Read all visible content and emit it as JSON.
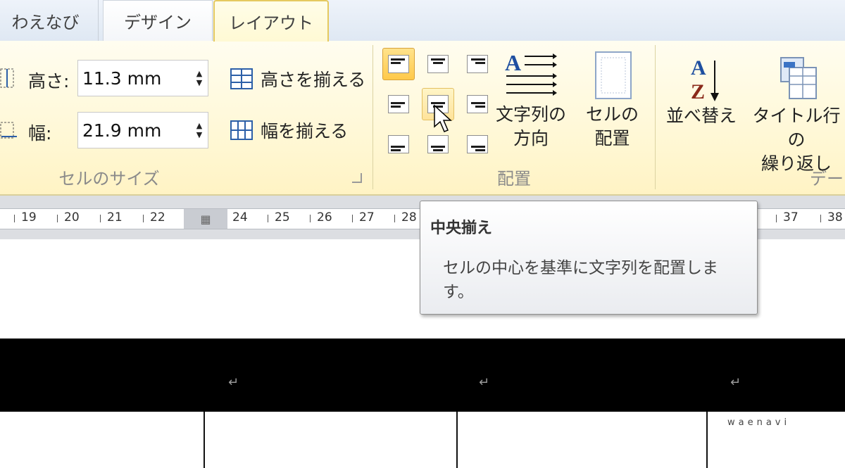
{
  "tabs": [
    {
      "label": "わえなび",
      "active": false
    },
    {
      "label": "デザイン",
      "active": false
    },
    {
      "label": "レイアウト",
      "active": true
    }
  ],
  "cell_size": {
    "height_label": "高さ:",
    "height_value": "11.3 mm",
    "width_label": "幅:",
    "width_value": "21.9 mm",
    "distribute_rows": "高さを揃える",
    "distribute_columns": "幅を揃える",
    "group_label": "セルのサイズ"
  },
  "alignment": {
    "group_label": "配置",
    "buttons": [
      "top-left",
      "top-center",
      "top-right",
      "middle-left",
      "middle-center",
      "middle-right",
      "bottom-left",
      "bottom-center",
      "bottom-right"
    ],
    "selected": "top-left",
    "hovered": "middle-center",
    "text_direction_label": [
      "文字列の",
      "方向"
    ],
    "cell_margins_label": [
      "セルの",
      "配置"
    ]
  },
  "data_group": {
    "sort_label": "並べ替え",
    "repeat_header_label": [
      "タイトル行の",
      "繰り返し"
    ],
    "group_label_partial": "デー"
  },
  "ruler": {
    "numbers_left": [
      "19",
      "20",
      "21",
      "22"
    ],
    "numbers_right": [
      "24",
      "25",
      "26",
      "27",
      "28"
    ],
    "numbers_far": [
      "37",
      "38"
    ]
  },
  "tooltip": {
    "title": "中央揃え",
    "description": "セルの中心を基準に文字列を配置します。"
  },
  "document": {
    "paragraph_mark": "↵",
    "watermark": "waenavi"
  },
  "colors": {
    "ribbon_bg": "#fff7d2",
    "active_tab_border": "#e5c95f",
    "selected_button": "#ffc94a",
    "table_header_fill": "#000000"
  }
}
